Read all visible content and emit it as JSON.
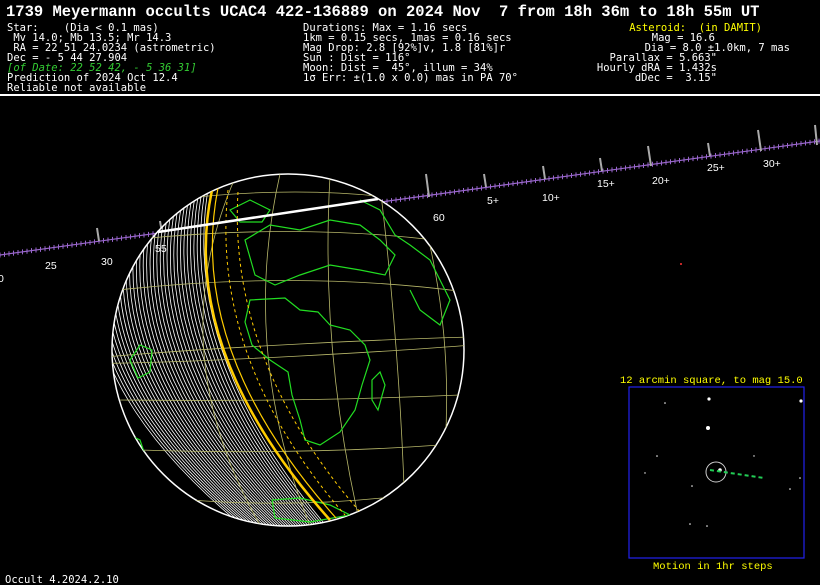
{
  "title": "1739 Meyermann occults UCAC4 422-136889 on 2024 Nov  7 from 18h 36m to 18h 55m UT",
  "star": {
    "line1": "Star:    (Dia < 0.1 mas)",
    "line2": " Mv 14.0; Mb 13.5; Mr 14.3",
    "line3": " RA = 22 51 24.0234 (astrometric)",
    "line4": "Dec = - 5 44 27.904",
    "line5": "[of Date: 22 52 42, - 5 36 31]",
    "line6": "Prediction of 2024 Oct 12.4",
    "line7": "Reliable not available"
  },
  "event": {
    "line1": "Durations: Max = 1.16 secs",
    "line2": "1km = 0.15 secs, 1mas = 0.16 secs",
    "line3": "Mag Drop: 2.8 [92%]v, 1.8 [81%]r",
    "line4": "Sun : Dist = 116°",
    "line5": "Moon: Dist =  45°, illum = 34%",
    "line6": "1σ Err: ±(1.0 x 0.0) mas in PA 70°"
  },
  "asteroid": {
    "header": "Asteroid:  (in DAMIT)",
    "mag": "Mag = 16.6",
    "dia": "Dia = 8.0 ±1.0km, 7 mas",
    "parallax": "Parallax = 5.663\"",
    "dra": "Hourly dRA = 1.432s",
    "ddec": "dDec =  3.15\""
  },
  "path_labels": [
    {
      "text": "0"
    },
    {
      "text": "25"
    },
    {
      "text": "30"
    },
    {
      "text": "55"
    },
    {
      "text": "60"
    },
    {
      "text": "5+"
    },
    {
      "text": "10+"
    },
    {
      "text": "15+"
    },
    {
      "text": "20+"
    },
    {
      "text": "25+"
    },
    {
      "text": "30+"
    }
  ],
  "finder": {
    "title": "12 arcmin square, to mag 15.0",
    "caption": "Motion in 1hr steps"
  },
  "footer": "Occult 4.2024.2.10",
  "colors": {
    "background": "#000000",
    "text": "#ffffff",
    "accent": "#ffff00",
    "coast": "#22dd22",
    "grid": "#b8b86a",
    "track": "#9966cc",
    "finder_box": "#2222ee",
    "path_edge": "#ffcc00"
  }
}
